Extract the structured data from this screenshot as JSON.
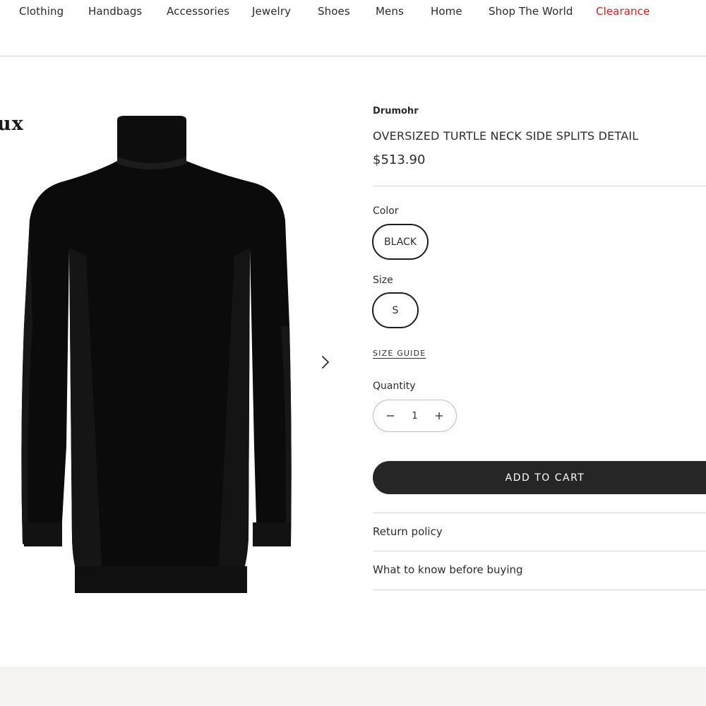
{
  "nav": {
    "items": [
      {
        "label": "Clothing"
      },
      {
        "label": "Handbags"
      },
      {
        "label": "Accessories"
      },
      {
        "label": "Jewelry"
      },
      {
        "label": "Shoes"
      },
      {
        "label": "Mens"
      },
      {
        "label": "Home"
      },
      {
        "label": "Shop The World"
      },
      {
        "label": "Clearance"
      }
    ],
    "clearance_color": "#d32020"
  },
  "brand_fragment": "ux",
  "product": {
    "vendor": "Drumohr",
    "title": "OVERSIZED TURTLE NECK SIDE SPLITS DETAIL",
    "price": "$513.90",
    "image_icon": "black-turtleneck-sweater-image",
    "gallery_next_icon": "chevron-right-icon"
  },
  "options": {
    "color_label": "Color",
    "color_value": "BLACK",
    "size_label": "Size",
    "size_value": "S",
    "size_guide": "SIZE GUIDE"
  },
  "quantity": {
    "label": "Quantity",
    "value": "1",
    "minus_icon": "minus-icon",
    "plus_icon": "plus-icon"
  },
  "cart": {
    "button_label": "ADD TO CART",
    "button_color": "#262626"
  },
  "accordions": [
    {
      "label": "Return policy"
    },
    {
      "label": "What to know before buying"
    }
  ]
}
